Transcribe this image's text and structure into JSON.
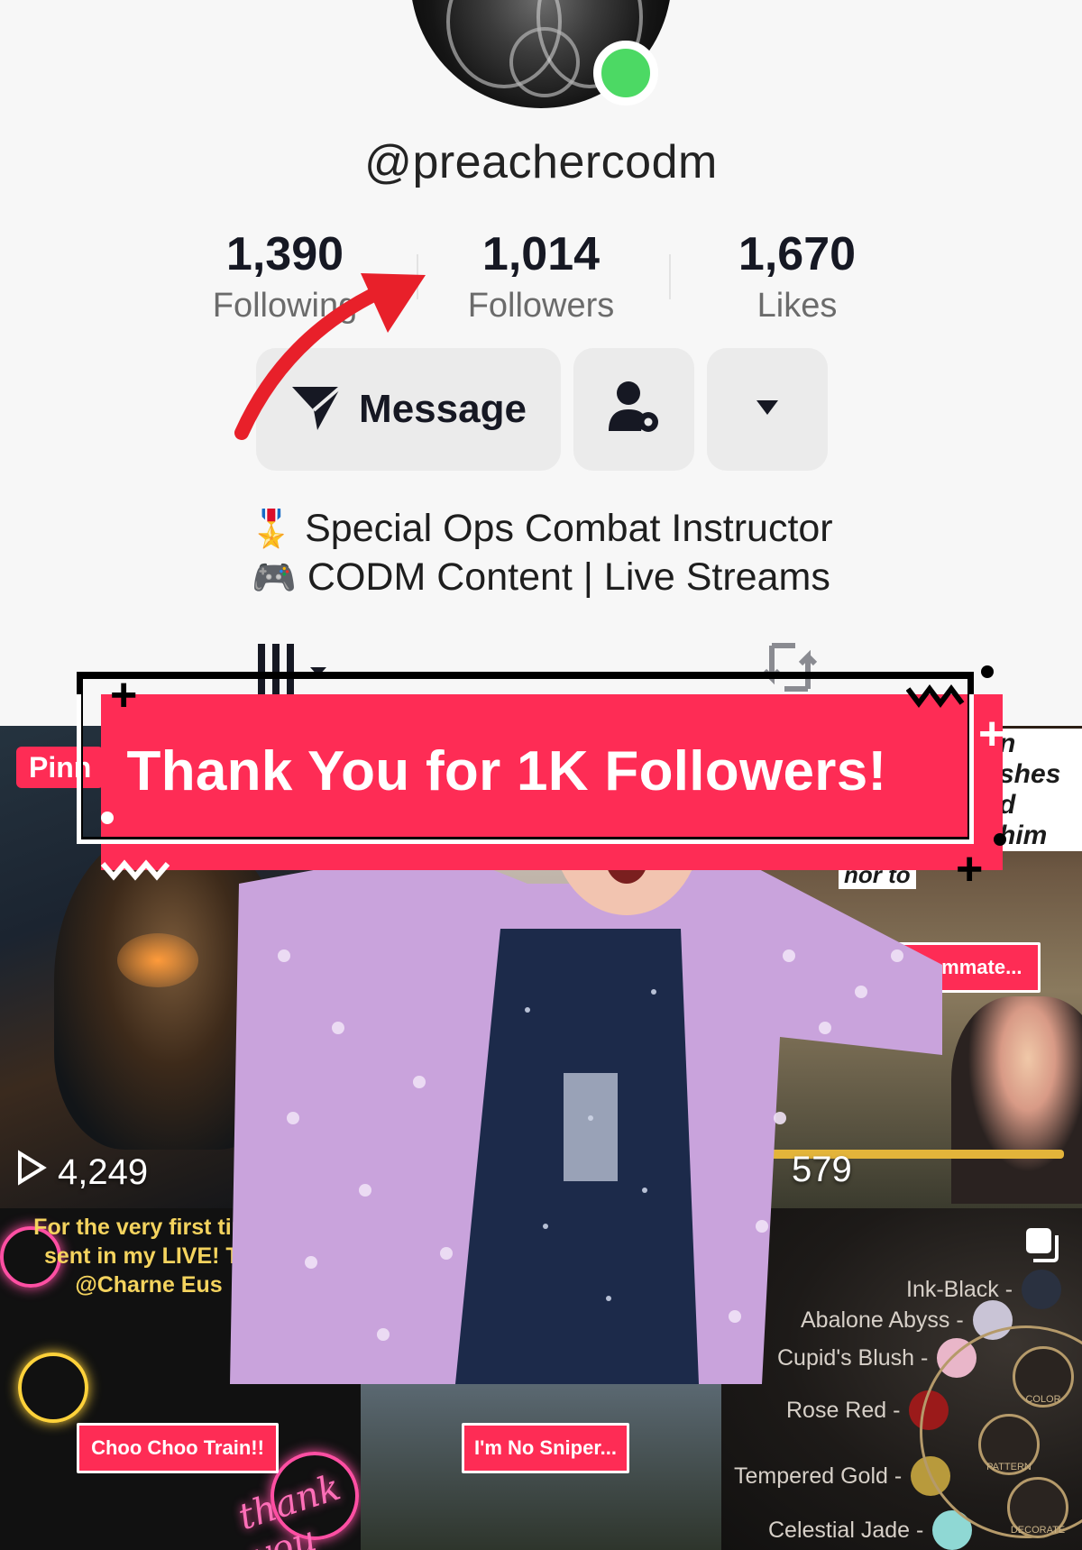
{
  "profile": {
    "username": "@preachercodm",
    "online": true,
    "stats": [
      {
        "value": "1,390",
        "label": "Following"
      },
      {
        "value": "1,014",
        "label": "Followers"
      },
      {
        "value": "1,670",
        "label": "Likes"
      }
    ],
    "buttons": {
      "message_label": "Message"
    },
    "bio": [
      "Special Ops Combat Instructor",
      "CODM Content | Live Streams"
    ]
  },
  "overlay": {
    "banner_text": "Thank You for 1K Followers!"
  },
  "grid": {
    "pinned_label": "Pinn",
    "tile1_views": "4,249",
    "tile3_views": "579",
    "tile3_caption_lines": [
      "n",
      "shes",
      "d",
      "him",
      "nor to"
    ],
    "tile3_tag": "The Random Teammate...",
    "tile4_caption": [
      "For the very first time",
      "sent in my LIVE! Th",
      "@Charne Eus"
    ],
    "tile4_tag": "Choo Choo Train!!",
    "tile4_neon": "thank you",
    "tile5_tag": "I'm No Sniper...",
    "tile6_colors": [
      {
        "name": "Ink-Black -",
        "hex": "#2a3140"
      },
      {
        "name": "Abalone Abyss -",
        "hex": "#c9c4d6"
      },
      {
        "name": "Cupid's Blush -",
        "hex": "#e9b6c9"
      },
      {
        "name": "Rose Red -",
        "hex": "#9b1a1a"
      },
      {
        "name": "Tempered Gold -",
        "hex": "#b89a3c"
      },
      {
        "name": "Celestial Jade -",
        "hex": "#8fd8d4"
      }
    ],
    "tile6_wheel": [
      "COLOR",
      "PATTERN",
      "DECORATE"
    ]
  },
  "colors": {
    "accent": "#fe2c55",
    "online": "#4cd964",
    "arrow": "#e8202a"
  },
  "icons": [
    "send-icon",
    "add-friend-settings-icon",
    "caret-down-icon",
    "grid-icon",
    "repost-icon",
    "play-icon",
    "copy-icon"
  ]
}
